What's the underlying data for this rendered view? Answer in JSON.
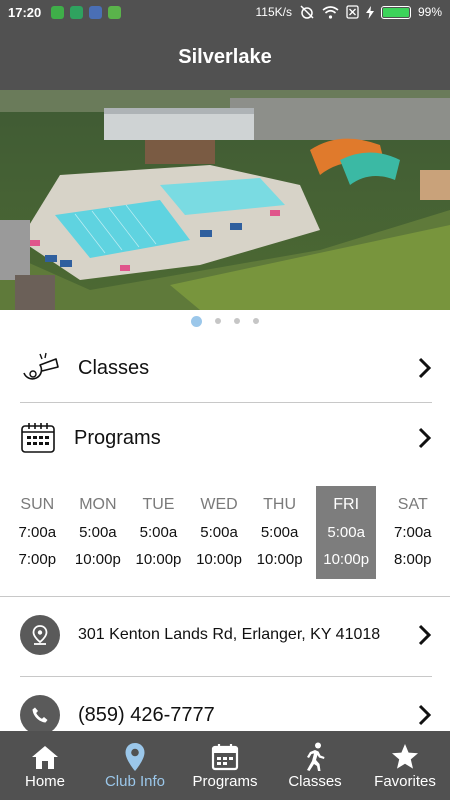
{
  "status": {
    "time": "17:20",
    "network_speed": "115K/s",
    "battery": "99%",
    "battery_level": 0.99
  },
  "header": {
    "title": "Silverlake"
  },
  "carousel": {
    "count": 4,
    "active_index": 0
  },
  "menu": [
    {
      "label": "Classes",
      "icon": "whistle-icon"
    },
    {
      "label": "Programs",
      "icon": "calendar-icon"
    }
  ],
  "hours": {
    "days": [
      {
        "name": "SUN",
        "open": "7:00a",
        "close": "7:00p"
      },
      {
        "name": "MON",
        "open": "5:00a",
        "close": "10:00p"
      },
      {
        "name": "TUE",
        "open": "5:00a",
        "close": "10:00p"
      },
      {
        "name": "WED",
        "open": "5:00a",
        "close": "10:00p"
      },
      {
        "name": "THU",
        "open": "5:00a",
        "close": "10:00p"
      },
      {
        "name": "FRI",
        "open": "5:00a",
        "close": "10:00p"
      },
      {
        "name": "SAT",
        "open": "7:00a",
        "close": "8:00p"
      }
    ],
    "today": "FRI"
  },
  "contact": {
    "address": "301 Kenton Lands Rd, Erlanger, KY 41018",
    "phone": "(859) 426-7777"
  },
  "tabs": [
    {
      "label": "Home",
      "icon": "home-icon"
    },
    {
      "label": "Club Info",
      "icon": "location-pin-icon",
      "active": true
    },
    {
      "label": "Programs",
      "icon": "calendar-icon"
    },
    {
      "label": "Classes",
      "icon": "running-person-icon"
    },
    {
      "label": "Favorites",
      "icon": "star-icon"
    }
  ],
  "colors": {
    "bar": "#515151",
    "accent": "#9bc7ea",
    "today_bg": "#7d7d7d"
  }
}
